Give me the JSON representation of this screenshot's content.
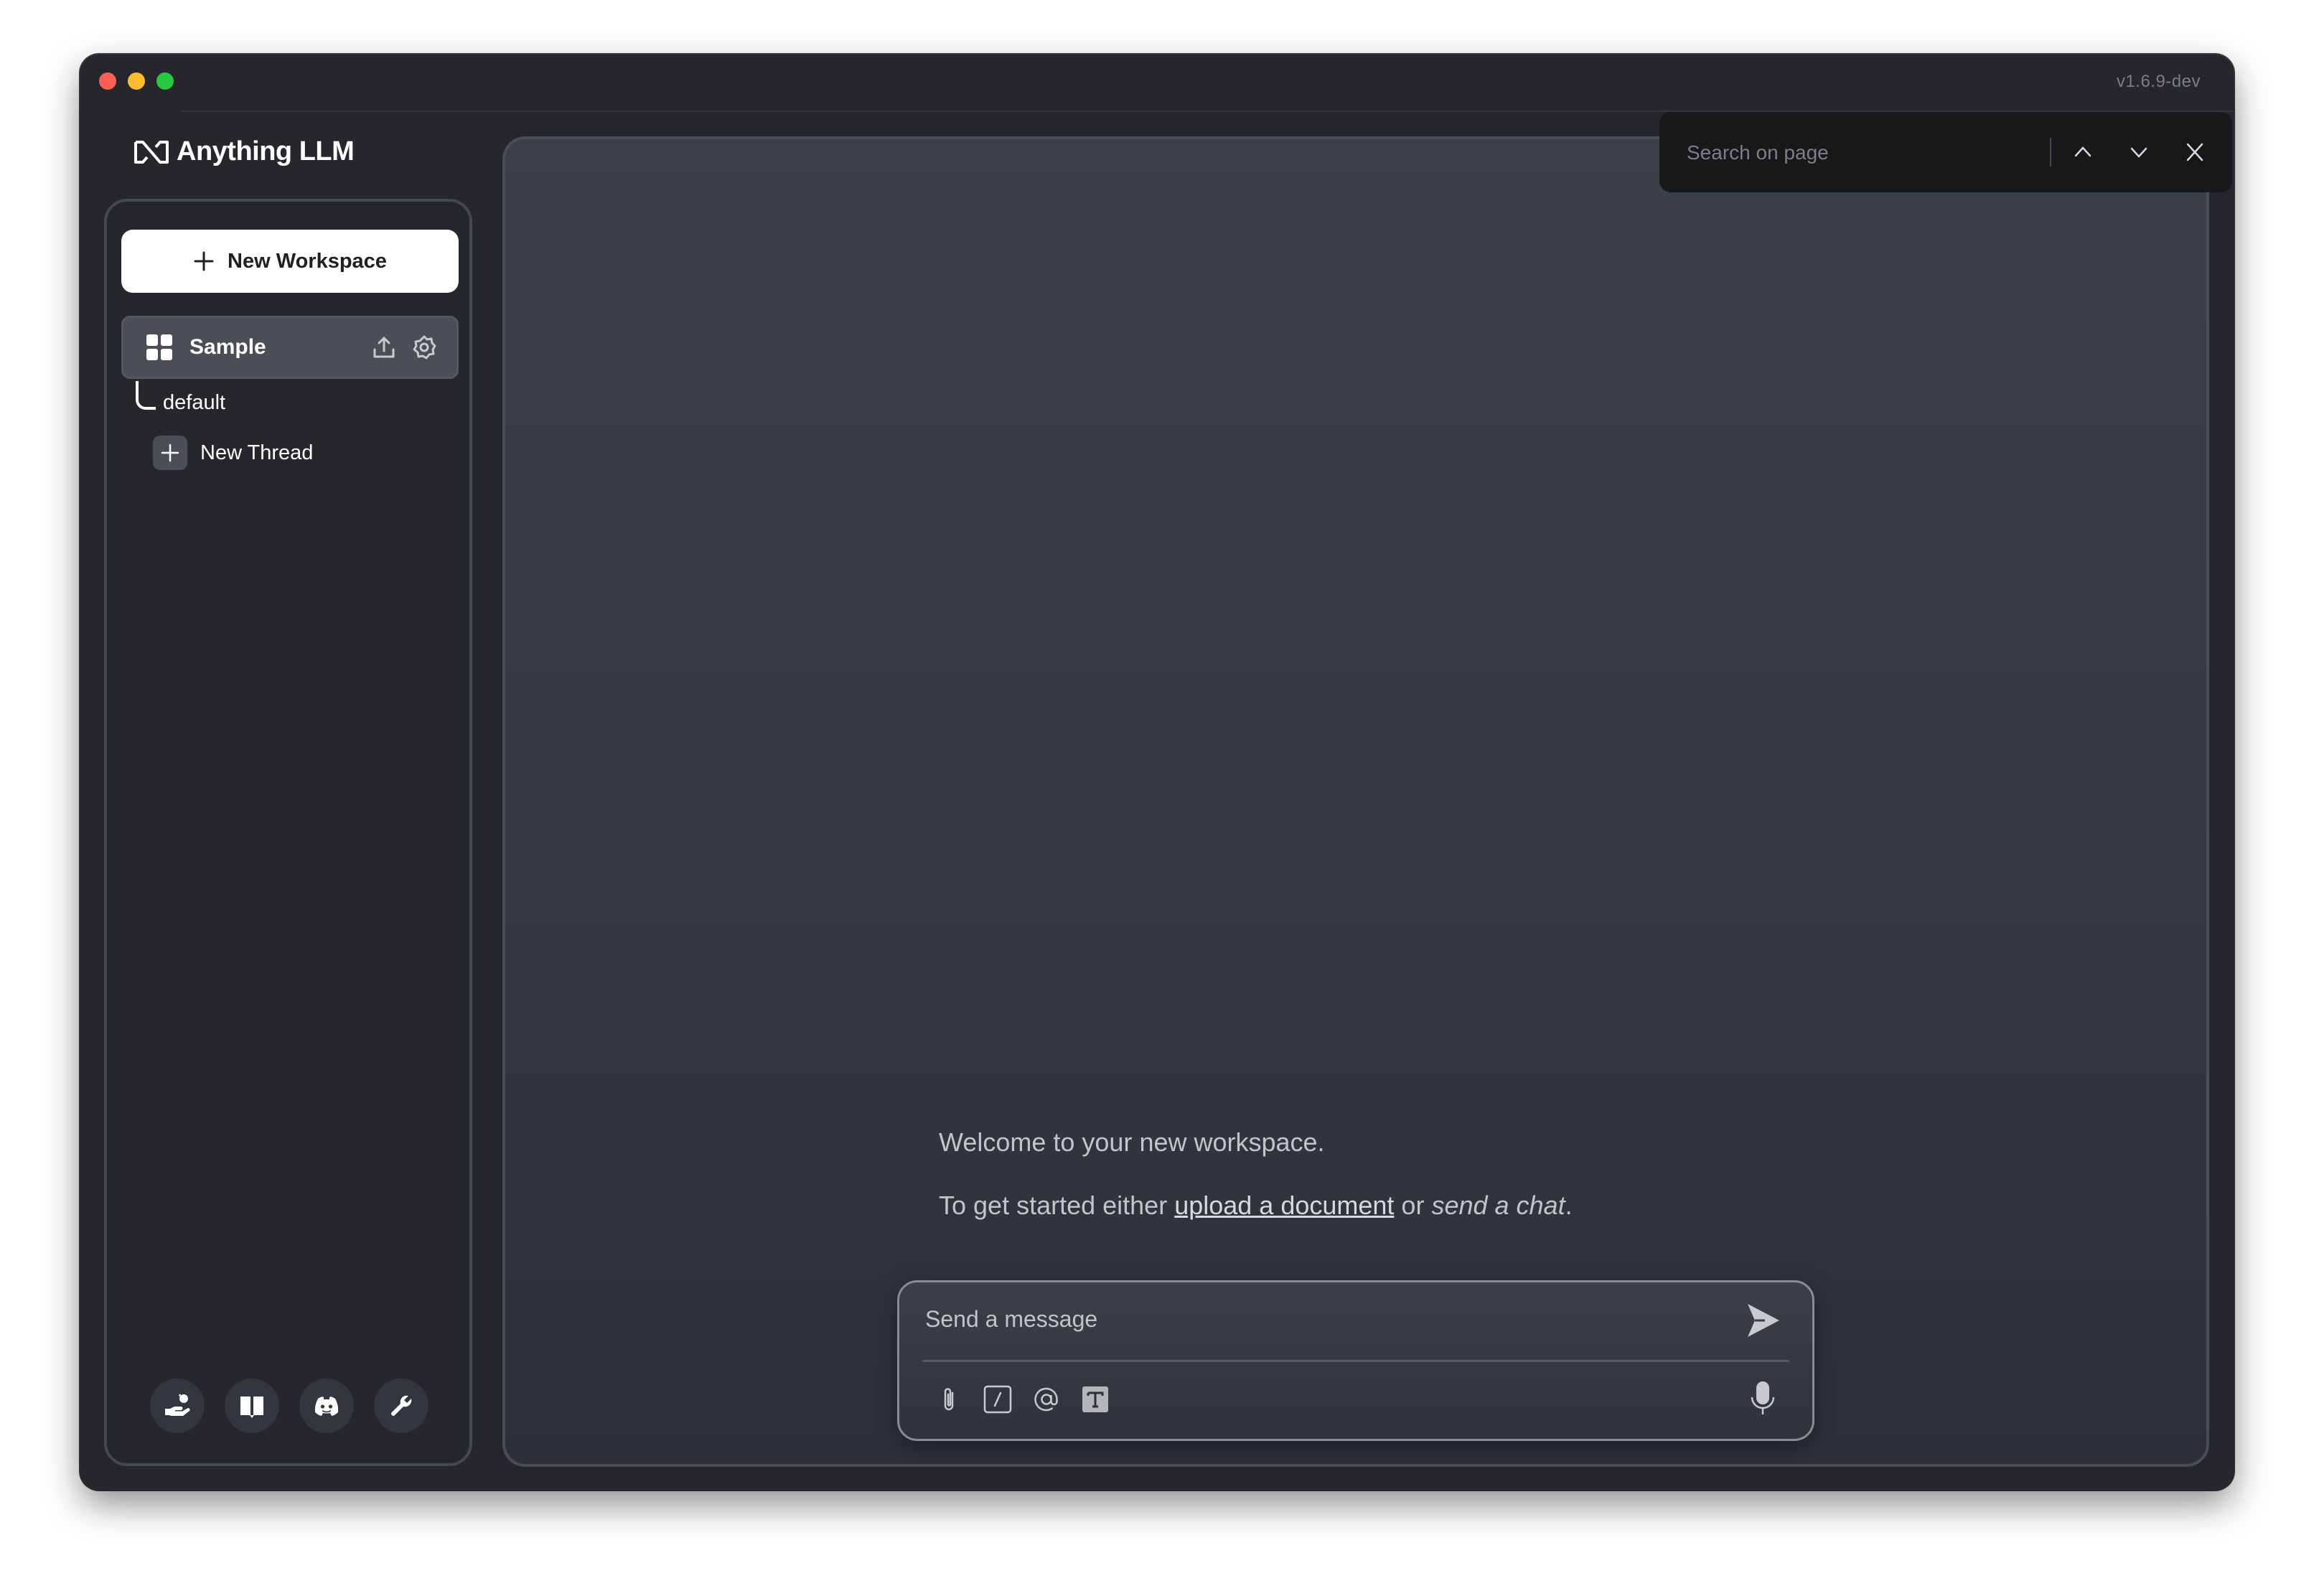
{
  "window": {
    "version": "v1.6.9-dev",
    "traffic_lights": [
      "close",
      "minimize",
      "maximize"
    ]
  },
  "app": {
    "name": "Anything LLM",
    "logo_icon": "anythingllm-logo-icon"
  },
  "sidebar": {
    "new_workspace_label": "New Workspace",
    "workspaces": [
      {
        "name": "Sample",
        "icon": "grid-icon",
        "actions": [
          "upload-icon",
          "gear-icon"
        ],
        "threads": [
          {
            "name": "default"
          }
        ]
      }
    ],
    "new_thread_label": "New Thread",
    "footer_icons": [
      "community-hand-icon",
      "book-icon",
      "discord-icon",
      "wrench-icon"
    ]
  },
  "main": {
    "welcome_line1": "Welcome to your new workspace.",
    "welcome_line2_prefix": "To get started either ",
    "welcome_link": "upload a document",
    "welcome_mid": " or ",
    "welcome_emph": "send a chat",
    "welcome_end": "."
  },
  "chat": {
    "placeholder": "Send a message",
    "value": "",
    "tools": [
      "paperclip-icon",
      "slash-command-icon",
      "at-mention-icon",
      "text-format-icon"
    ],
    "send_icon": "send-icon",
    "mic_icon": "microphone-icon"
  },
  "search": {
    "placeholder": "Search on page",
    "value": ""
  },
  "colors": {
    "window_bg": "#26272c",
    "panel_top": "#3b3f48",
    "panel_bottom": "#2e3039",
    "selected_workspace": "#4b4e55",
    "search_bg": "#18181b"
  }
}
